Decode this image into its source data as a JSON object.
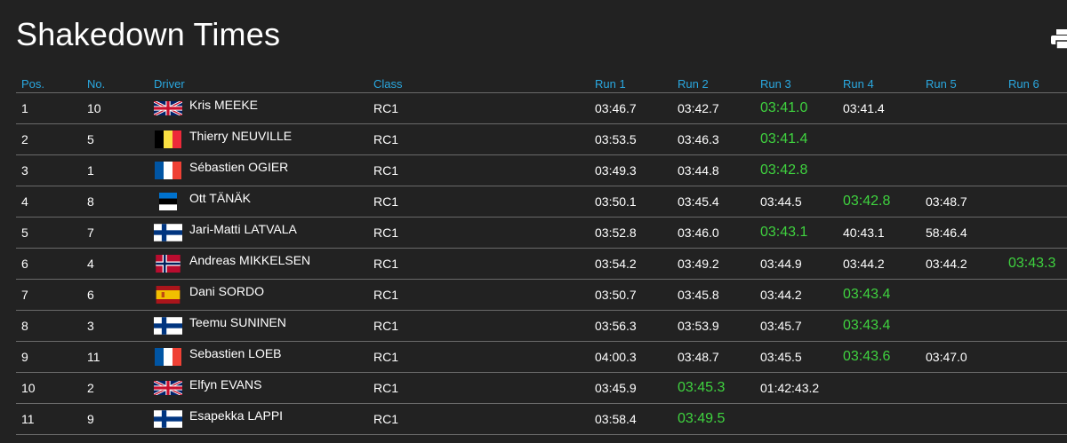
{
  "page": {
    "title": "Shakedown Times"
  },
  "colors": {
    "background": "#222222",
    "header_text": "#2aa8e0",
    "best_time": "#3fd33f",
    "normal_time": "#a6a6a6"
  },
  "table": {
    "headers": {
      "pos": "Pos.",
      "no": "No.",
      "driver": "Driver",
      "class": "Class",
      "run1": "Run 1",
      "run2": "Run 2",
      "run3": "Run 3",
      "run4": "Run 4",
      "run5": "Run 5",
      "run6": "Run 6"
    },
    "rows": [
      {
        "pos": "1",
        "no": "10",
        "flag": "gb",
        "driver": "Kris MEEKE",
        "class": "RC1",
        "runs": [
          "03:46.7",
          "03:42.7",
          "03:41.0",
          "03:41.4",
          "",
          ""
        ],
        "best": 2
      },
      {
        "pos": "2",
        "no": "5",
        "flag": "be",
        "driver": "Thierry NEUVILLE",
        "class": "RC1",
        "runs": [
          "03:53.5",
          "03:46.3",
          "03:41.4",
          "",
          "",
          ""
        ],
        "best": 2
      },
      {
        "pos": "3",
        "no": "1",
        "flag": "fr",
        "driver": "Sébastien OGIER",
        "class": "RC1",
        "runs": [
          "03:49.3",
          "03:44.8",
          "03:42.8",
          "",
          "",
          ""
        ],
        "best": 2
      },
      {
        "pos": "4",
        "no": "8",
        "flag": "ee",
        "driver": "Ott TÄNÄK",
        "class": "RC1",
        "runs": [
          "03:50.1",
          "03:45.4",
          "03:44.5",
          "03:42.8",
          "03:48.7",
          ""
        ],
        "best": 3
      },
      {
        "pos": "5",
        "no": "7",
        "flag": "fi",
        "driver": "Jari-Matti LATVALA",
        "class": "RC1",
        "runs": [
          "03:52.8",
          "03:46.0",
          "03:43.1",
          "40:43.1",
          "58:46.4",
          ""
        ],
        "best": 2
      },
      {
        "pos": "6",
        "no": "4",
        "flag": "no",
        "driver": "Andreas MIKKELSEN",
        "class": "RC1",
        "runs": [
          "03:54.2",
          "03:49.2",
          "03:44.9",
          "03:44.2",
          "03:44.2",
          "03:43.3"
        ],
        "best": 5
      },
      {
        "pos": "7",
        "no": "6",
        "flag": "es",
        "driver": "Dani SORDO",
        "class": "RC1",
        "runs": [
          "03:50.7",
          "03:45.8",
          "03:44.2",
          "03:43.4",
          "",
          ""
        ],
        "best": 3
      },
      {
        "pos": "8",
        "no": "3",
        "flag": "fi",
        "driver": "Teemu SUNINEN",
        "class": "RC1",
        "runs": [
          "03:56.3",
          "03:53.9",
          "03:45.7",
          "03:43.4",
          "",
          ""
        ],
        "best": 3
      },
      {
        "pos": "9",
        "no": "11",
        "flag": "fr",
        "driver": "Sebastien LOEB",
        "class": "RC1",
        "runs": [
          "04:00.3",
          "03:48.7",
          "03:45.5",
          "03:43.6",
          "03:47.0",
          ""
        ],
        "best": 3
      },
      {
        "pos": "10",
        "no": "2",
        "flag": "gb",
        "driver": "Elfyn EVANS",
        "class": "RC1",
        "runs": [
          "03:45.9",
          "03:45.3",
          "01:42:43.2",
          "",
          "",
          ""
        ],
        "best": 1
      },
      {
        "pos": "11",
        "no": "9",
        "flag": "fi",
        "driver": "Esapekka LAPPI",
        "class": "RC1",
        "runs": [
          "03:58.4",
          "03:49.5",
          "",
          "",
          "",
          ""
        ],
        "best": 1
      }
    ]
  }
}
